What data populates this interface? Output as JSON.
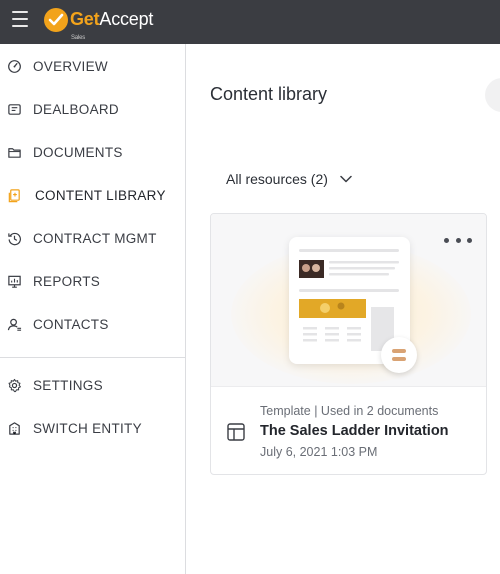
{
  "app": {
    "brand_primary": "Get",
    "brand_secondary": "Accept",
    "brand_sub": "Sales",
    "brand_color": "#f2a31b",
    "topbar_color": "#3b3d42"
  },
  "sidebar": {
    "items": [
      {
        "label": "OVERVIEW",
        "icon": "gauge-icon"
      },
      {
        "label": "DEALBOARD",
        "icon": "dealboard-icon"
      },
      {
        "label": "DOCUMENTS",
        "icon": "folder-icon"
      },
      {
        "label": "CONTENT LIBRARY",
        "icon": "content-library-icon",
        "active": true
      },
      {
        "label": "CONTRACT MGMT",
        "icon": "history-icon"
      },
      {
        "label": "REPORTS",
        "icon": "report-icon"
      },
      {
        "label": "CONTACTS",
        "icon": "contacts-icon"
      }
    ],
    "bottom_items": [
      {
        "label": "SETTINGS",
        "icon": "gear-icon"
      },
      {
        "label": "SWITCH ENTITY",
        "icon": "building-icon"
      }
    ]
  },
  "main": {
    "title": "Content library",
    "filter_label": "All resources (2)",
    "cards": [
      {
        "meta": "Template | Used in 2 documents",
        "name": "The Sales Ladder Invitation",
        "date": "July 6, 2021 1:03 PM",
        "type_icon": "template-layout-icon"
      }
    ]
  }
}
